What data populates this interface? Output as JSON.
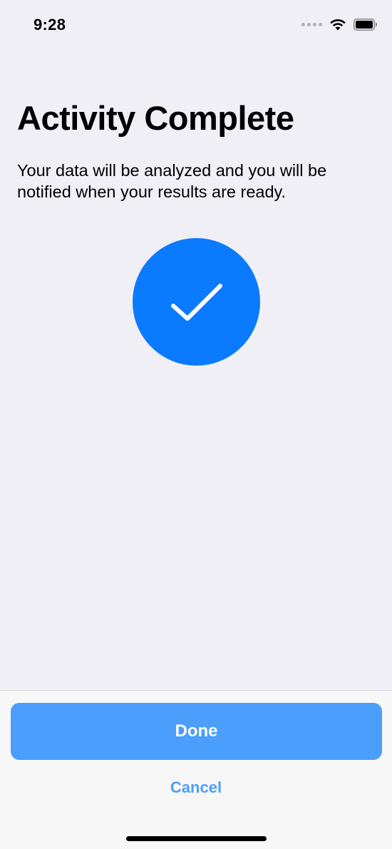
{
  "status_bar": {
    "time": "9:28",
    "icons": [
      "signal-dots-icon",
      "wifi-icon",
      "battery-icon"
    ]
  },
  "content": {
    "title": "Activity Complete",
    "subtitle": "Your data will be analyzed and you will be notified when your results are ready.",
    "completion_icon": "checkmark-icon",
    "accent_color": "#0a7aff"
  },
  "footer": {
    "done_label": "Done",
    "cancel_label": "Cancel",
    "button_color": "#4b9efc"
  }
}
